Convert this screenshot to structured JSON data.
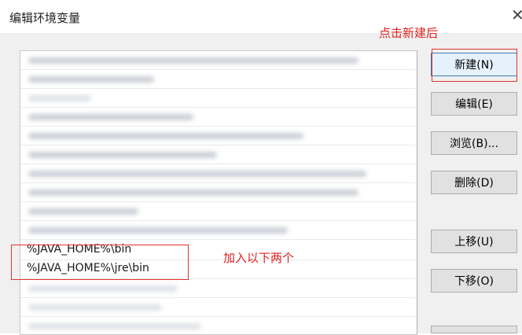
{
  "window": {
    "title": "编辑环境变量",
    "close_glyph": "✕"
  },
  "list": {
    "items": [
      {
        "text": "%JAVA_HOME%\\bin"
      },
      {
        "text": "%JAVA_HOME%\\jre\\bin"
      }
    ]
  },
  "buttons": {
    "new": "新建(N)",
    "edit": "编辑(E)",
    "browse": "浏览(B)...",
    "delete": "删除(D)",
    "move_up": "上移(U)",
    "move_down": "下移(O)"
  },
  "annotations": {
    "after_new": "点击新建后",
    "add_two": "加入以下两个",
    "color": "#e02020"
  }
}
